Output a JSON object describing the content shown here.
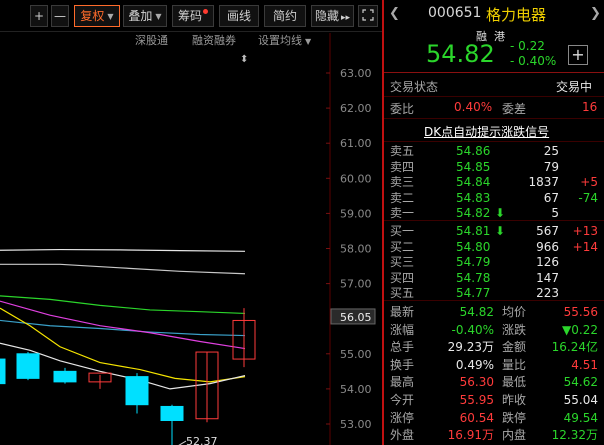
{
  "toolbar": {
    "zoom_in": "+",
    "zoom_out": "—",
    "fuquan": "复权",
    "diejia": "叠加",
    "chouma": "筹码",
    "huaxian": "画线",
    "jianyue": "简约",
    "yincang": "隐藏"
  },
  "subbar": {
    "shengutong": "深股通",
    "rongzirongquan": "融资融券",
    "shezhi_junxian": "设置均线"
  },
  "chart": {
    "price_axis": [
      "63.00",
      "62.00",
      "61.00",
      "60.00",
      "59.00",
      "58.00",
      "57.00",
      "56.05",
      "55.00",
      "54.00",
      "53.00"
    ],
    "current_price_tag": "56.05",
    "low_marker": "52.37",
    "colors": {
      "up": "#ff3b3b",
      "down": "#00e0ff",
      "ma_white": "#e6e6e6",
      "ma_yellow": "#f5e400",
      "ma_magenta": "#e040e0",
      "ma_green": "#2bd62b",
      "ma_cyan": "#3aa0c8"
    }
  },
  "quote": {
    "code": "000651",
    "name": "格力电器",
    "badge_rong": "融",
    "badge_gang": "港",
    "price": "54.82",
    "change": "- 0.22",
    "change_pct": "- 0.40%",
    "add_button": "+"
  },
  "status": {
    "label": "交易状态",
    "value": "交易中"
  },
  "weibi": {
    "label_ratio": "委比",
    "ratio": "0.40%",
    "label_diff": "委差",
    "diff": "16"
  },
  "dk_link": "DK点自动提示涨跌信号",
  "orderbook": {
    "asks": [
      {
        "label": "卖五",
        "price": "54.86",
        "vol": "25",
        "delta": ""
      },
      {
        "label": "卖四",
        "price": "54.85",
        "vol": "79",
        "delta": ""
      },
      {
        "label": "卖三",
        "price": "54.84",
        "vol": "1837",
        "delta": "+5"
      },
      {
        "label": "卖二",
        "price": "54.83",
        "vol": "67",
        "delta": "-74"
      },
      {
        "label": "卖一",
        "price": "54.82",
        "arrow": "⬇",
        "vol": "5",
        "delta": ""
      }
    ],
    "bids": [
      {
        "label": "买一",
        "price": "54.81",
        "arrow": "⬇",
        "vol": "567",
        "delta": "+13"
      },
      {
        "label": "买二",
        "price": "54.80",
        "vol": "966",
        "delta": "+14"
      },
      {
        "label": "买三",
        "price": "54.79",
        "vol": "126",
        "delta": ""
      },
      {
        "label": "买四",
        "price": "54.78",
        "vol": "147",
        "delta": ""
      },
      {
        "label": "买五",
        "price": "54.77",
        "vol": "223",
        "delta": ""
      }
    ]
  },
  "stats": [
    {
      "l1": "最新",
      "v1": "54.82",
      "l2": "均价",
      "v2": "55.56"
    },
    {
      "l1": "涨幅",
      "v1": "-0.40%",
      "l2": "涨跌",
      "v2": "▼0.22"
    },
    {
      "l1": "总手",
      "v1": "29.23万",
      "l2": "金额",
      "v2": "16.24亿"
    },
    {
      "l1": "换手",
      "v1": "0.49%",
      "l2": "量比",
      "v2": "4.51"
    },
    {
      "l1": "最高",
      "v1": "56.30",
      "l2": "最低",
      "v2": "54.62"
    },
    {
      "l1": "今开",
      "v1": "55.95",
      "l2": "昨收",
      "v2": "55.04"
    },
    {
      "l1": "涨停",
      "v1": "60.54",
      "l2": "跌停",
      "v2": "49.54"
    },
    {
      "l1": "外盘",
      "v1": "16.91万",
      "l2": "内盘",
      "v2": "12.32万"
    }
  ]
}
